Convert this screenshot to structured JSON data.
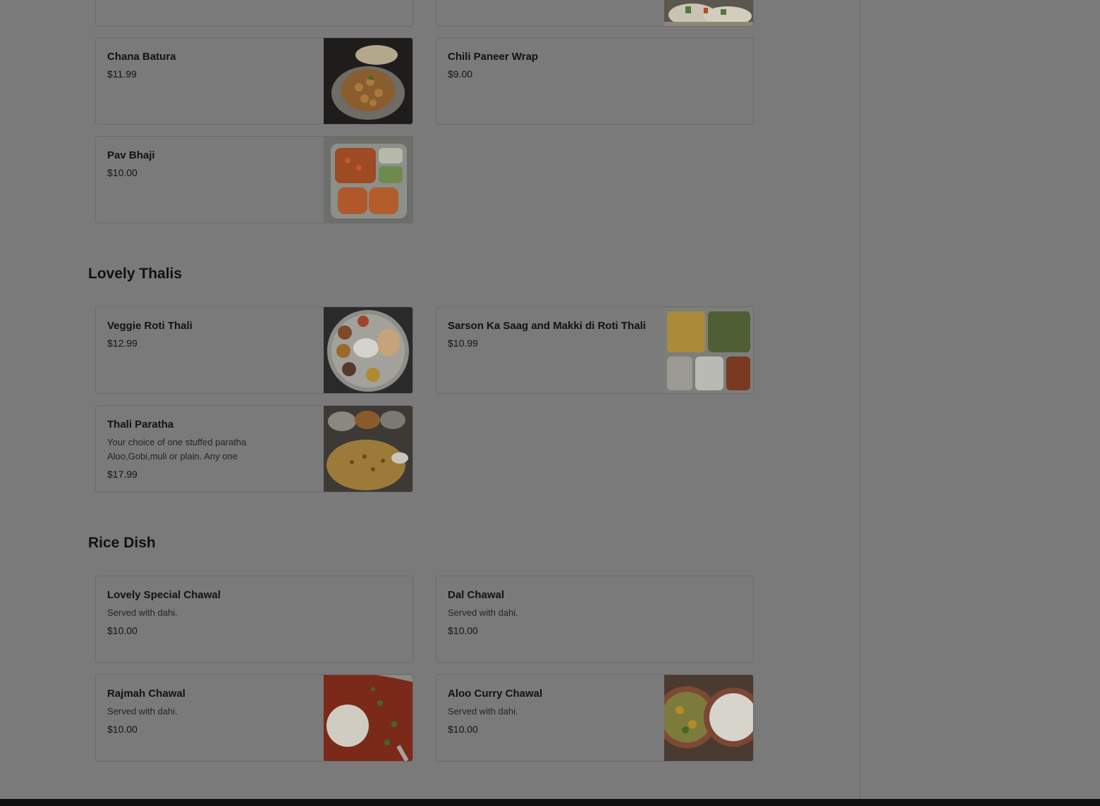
{
  "sections": [
    {
      "title": ""
    },
    {
      "title": "Lovely Thalis"
    },
    {
      "title": "Rice Dish"
    }
  ],
  "top_items": {
    "chana_batura": {
      "name": "Chana Batura",
      "price": "$11.99"
    },
    "chili_paneer_wrap": {
      "name": "Chili Paneer Wrap",
      "price": "$9.00"
    },
    "pav_bhaji": {
      "name": "Pav Bhaji",
      "price": "$10.00"
    }
  },
  "thalis": {
    "veggie_roti": {
      "name": "Veggie Roti Thali",
      "price": "$12.99"
    },
    "sarson": {
      "name": "Sarson Ka Saag and Makki di Roti Thali",
      "price": "$10.99"
    },
    "thali_paratha": {
      "name": "Thali Paratha",
      "desc_line1": "Your choice of one stuffed paratha",
      "desc_line2": "Aloo,Gobi,muli or plain. Any one",
      "price": "$17.99"
    }
  },
  "rice": {
    "lovely_special": {
      "name": "Lovely Special Chawal",
      "desc": "Served with dahi.",
      "price": "$10.00"
    },
    "dal_chawal": {
      "name": "Dal Chawal",
      "desc": "Served with dahi.",
      "price": "$10.00"
    },
    "rajmah": {
      "name": "Rajmah Chawal",
      "desc": "Served with dahi.",
      "price": "$10.00"
    },
    "aloo_curry": {
      "name": "Aloo Curry Chawal",
      "desc": "Served with dahi.",
      "price": "$10.00"
    }
  }
}
